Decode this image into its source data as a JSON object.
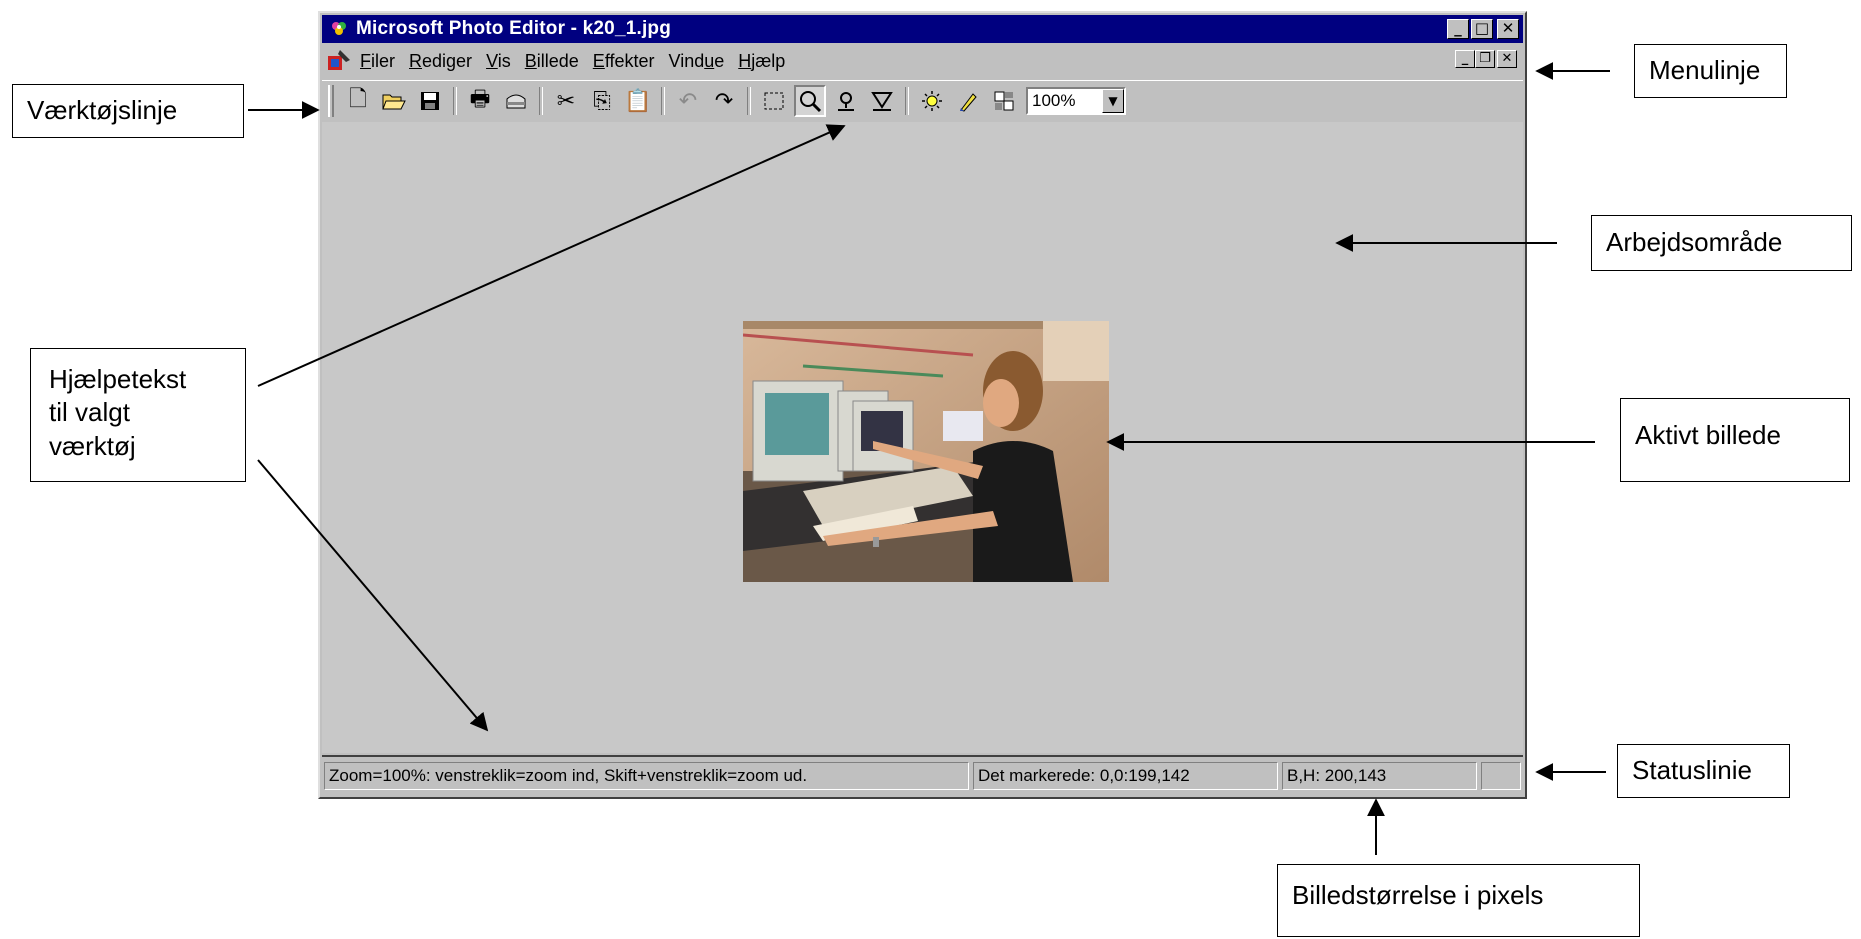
{
  "window": {
    "title": "Microsoft Photo Editor - k20_1.jpg",
    "title_bar_color": "#000080"
  },
  "menubar": {
    "items": [
      {
        "underline": "F",
        "rest": "iler"
      },
      {
        "underline": "R",
        "rest": "ediger"
      },
      {
        "underline": "V",
        "rest": "is"
      },
      {
        "underline": "B",
        "rest": "illede"
      },
      {
        "underline": "E",
        "rest": "ffekter"
      },
      {
        "prefix": "Vind",
        "underline": "u",
        "rest": "e"
      },
      {
        "underline": "H",
        "rest": "jælp"
      }
    ]
  },
  "toolbar": {
    "icons": [
      "new-icon",
      "open-icon",
      "save-icon",
      "print-icon",
      "scan-icon",
      "cut-icon",
      "copy-icon",
      "paste-icon",
      "undo-icon",
      "redo-icon",
      "select-icon",
      "zoom-icon",
      "smudge-icon",
      "sharpen-icon",
      "balance-icon",
      "retouch-icon",
      "properties-icon"
    ],
    "zoom_value": "100%"
  },
  "statusbar": {
    "help_text": "Zoom=100%: venstreklik=zoom ind, Skift+venstreklik=zoom ud.",
    "selection": "Det markerede: 0,0:199,142",
    "size": "B,H: 200,143"
  },
  "annotations": {
    "toolbar": "Værktøjslinje",
    "menubar": "Menulinje",
    "workarea": "Arbejdsområde",
    "helptext_line1": "Hjælpetekst",
    "helptext_line2": "til valgt",
    "helptext_line3": "værktøj",
    "active_image": "Aktivt billede",
    "statusbar": "Statuslinie",
    "image_size": "Billedstørrelse i pixels"
  }
}
